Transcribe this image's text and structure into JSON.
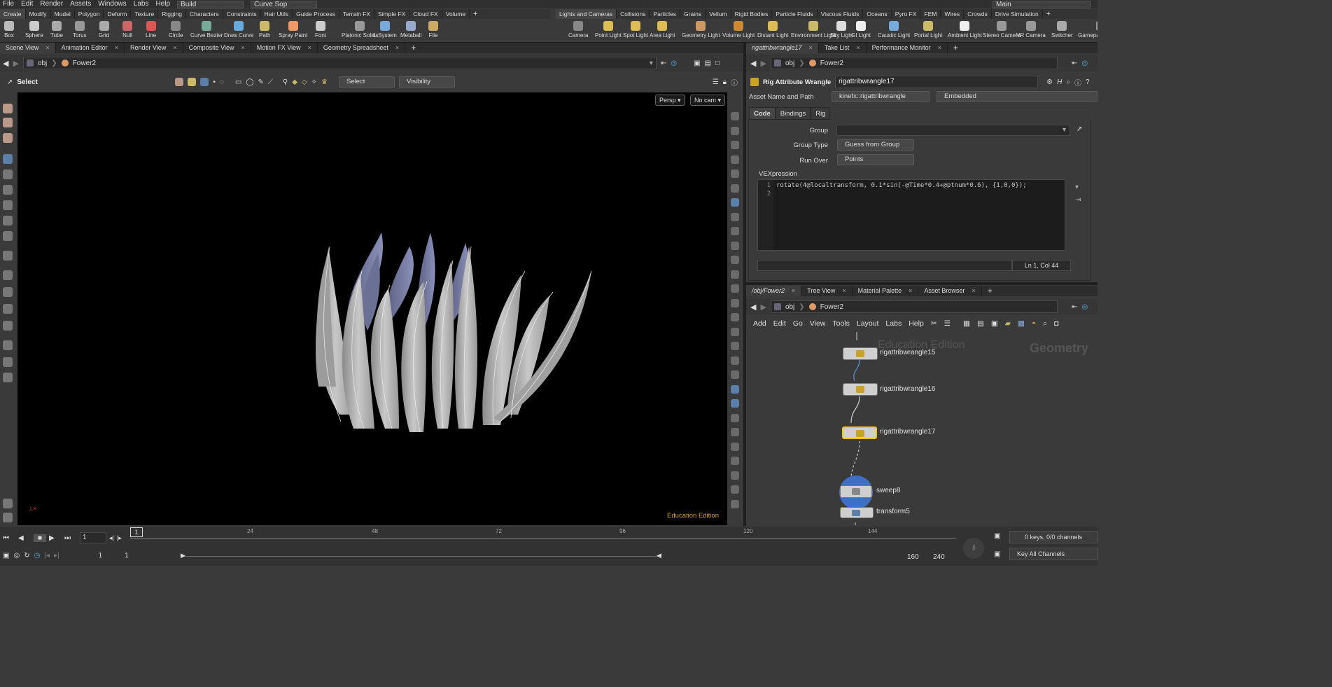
{
  "menubar": {
    "items": [
      "File",
      "Edit",
      "Render",
      "Assets",
      "Windows",
      "Labs",
      "Help"
    ],
    "desktop": "Build",
    "context": "Curve Sop",
    "main": "Main"
  },
  "shelf_tabs_left": [
    "Create",
    "Modify",
    "Model",
    "Polygon",
    "Deform",
    "Texture",
    "Rigging",
    "Characters",
    "Constraints",
    "Hair Utils",
    "Guide Process",
    "Terrain FX",
    "Simple FX",
    "Cloud FX",
    "Volume"
  ],
  "shelf_tabs_right": [
    "Lights and Cameras",
    "Collisions",
    "Particles",
    "Grains",
    "Vellum",
    "Rigid Bodies",
    "Particle Fluids",
    "Viscous Fluids",
    "Oceans",
    "Pyro FX",
    "FEM",
    "Wires",
    "Crowds",
    "Drive Simulation"
  ],
  "shelf_tools_left": [
    "Box",
    "Sphere",
    "Tube",
    "Torus",
    "Grid",
    "Null",
    "Line",
    "Circle",
    "Curve Bezier",
    "Draw Curve",
    "Path",
    "Spray Paint",
    "Font",
    "Platonic Solids",
    "L-System",
    "Metaball",
    "File"
  ],
  "shelf_tools_right": [
    "Camera",
    "Point Light",
    "Spot Light",
    "Area Light",
    "Geometry Light",
    "Volume Light",
    "Distant Light",
    "Environment Light",
    "Sky Light",
    "GI Light",
    "Caustic Light",
    "Portal Light",
    "Ambient Light",
    "Stereo Camera",
    "VR Camera",
    "Switcher",
    "Gamepad Camera"
  ],
  "scene_tabs": [
    "Scene View",
    "Animation Editor",
    "Render View",
    "Composite View",
    "Motion FX View",
    "Geometry Spreadsheet"
  ],
  "scene_path": {
    "root": "obj",
    "node": "Fower2"
  },
  "viewport_toolbar": {
    "tool": "Select",
    "select_menu": "Select",
    "visibility_menu": "Visibility"
  },
  "viewport": {
    "persp": "Persp ▾",
    "cam": "No cam ▾",
    "edition": "Education Edition"
  },
  "right_tabs": [
    "rigattribwrangle17",
    "Take List",
    "Performance Monitor"
  ],
  "right_path": {
    "root": "obj",
    "node": "Fower2"
  },
  "parm": {
    "type": "Rig Attribute Wrangle",
    "name": "rigattribwrangle17",
    "asset_label": "Asset Name and Path",
    "asset_value": "kinefx::rigattribwrangle",
    "asset_location": "Embedded",
    "tabs": [
      "Code",
      "Bindings",
      "Rig"
    ],
    "group_label": "Group",
    "group_type_label": "Group Type",
    "group_type_value": "Guess from Group",
    "run_over_label": "Run Over",
    "run_over_value": "Points",
    "vex_label": "VEXpression",
    "code_line1": "rotate(4@localtransform, 0.1*sin(-@Time*0.4+@ptnum*0.6), {1,0,0});",
    "line_numbers": [
      "1",
      "2"
    ],
    "cursor": "Ln 1, Col 44"
  },
  "net_tabs": [
    "/obj/Fower2",
    "Tree View",
    "Material Palette",
    "Asset Browser"
  ],
  "net_path": {
    "root": "obj",
    "node": "Fower2"
  },
  "net_menu": [
    "Add",
    "Edit",
    "Go",
    "View",
    "Tools",
    "Layout",
    "Labs",
    "Help"
  ],
  "network": {
    "watermark": "Education Edition",
    "context": "Geometry",
    "nodes": [
      "rigattribwrangle15",
      "rigattribwrangle16",
      "rigattribwrangle17",
      "sweep8",
      "transform5"
    ]
  },
  "timeline": {
    "ticks": [
      "24",
      "48",
      "72",
      "96",
      "120",
      "144"
    ],
    "current_frame": "1",
    "marker": "1",
    "start": "1",
    "start2": "1",
    "end": "160",
    "end2": "240",
    "keys": "0 keys, 0/0 channels",
    "key_all": "Key All Channels"
  },
  "colors": {
    "accent": "#f0c419",
    "edu": "#d9a03a",
    "viewport_bg": "#000000"
  }
}
